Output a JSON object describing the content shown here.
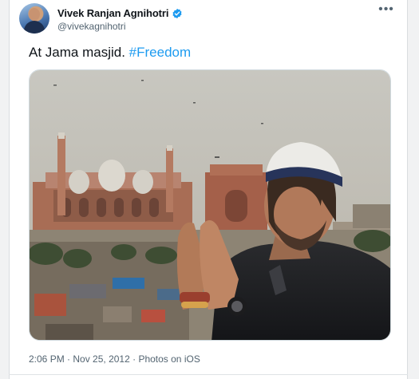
{
  "author": {
    "display_name": "Vivek Ranjan Agnihotri",
    "handle": "@vivekagnihotri",
    "verified": true
  },
  "tweet": {
    "text_prefix": "At Jama masjid. ",
    "hashtag": "#Freedom"
  },
  "meta": {
    "time": "2:06 PM",
    "separator_1": " · ",
    "date": "Nov 25, 2012",
    "separator_2": " · ",
    "source": "Photos on iOS"
  },
  "icons": {
    "more": "more-options-icon",
    "verified": "verified-badge-icon"
  },
  "colors": {
    "accent": "#1d9bf0",
    "text_primary": "#0f1419",
    "text_secondary": "#536471"
  }
}
